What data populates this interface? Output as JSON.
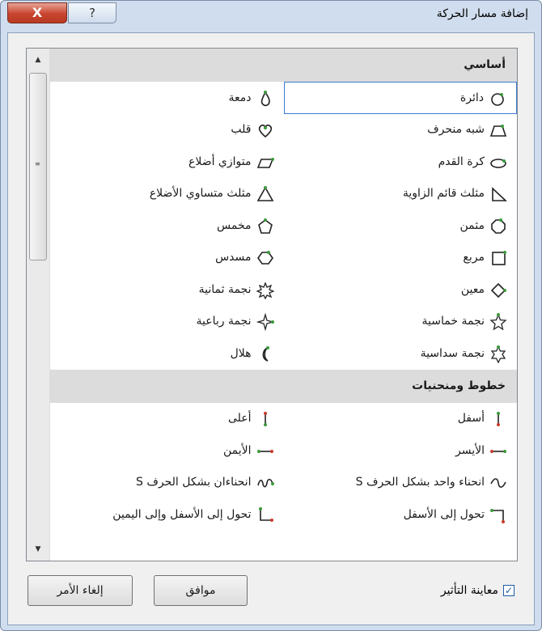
{
  "window": {
    "title": "إضافة مسار الحركة"
  },
  "titlebar": {
    "close_label": "X",
    "help_label": "?"
  },
  "groups": [
    {
      "header": "أساسي",
      "items": [
        {
          "label": "دائرة",
          "icon": "circle-icon"
        },
        {
          "label": "دمعة",
          "icon": "teardrop-icon"
        },
        {
          "label": "شبه منحرف",
          "icon": "trapezoid-icon"
        },
        {
          "label": "قلب",
          "icon": "heart-icon"
        },
        {
          "label": "كرة القدم",
          "icon": "football-icon"
        },
        {
          "label": "متوازي أضلاع",
          "icon": "parallelogram-icon"
        },
        {
          "label": "مثلث قائم الزاوية",
          "icon": "right-triangle-icon"
        },
        {
          "label": "مثلث متساوي الأضلاع",
          "icon": "equilateral-triangle-icon"
        },
        {
          "label": "مثمن",
          "icon": "octagon-icon"
        },
        {
          "label": "مخمس",
          "icon": "pentagon-icon"
        },
        {
          "label": "مربع",
          "icon": "square-icon"
        },
        {
          "label": "مسدس",
          "icon": "hexagon-icon"
        },
        {
          "label": "معين",
          "icon": "diamond-icon"
        },
        {
          "label": "نجمة ثمانية",
          "icon": "eight-point-star-icon"
        },
        {
          "label": "نجمة خماسية",
          "icon": "five-point-star-icon"
        },
        {
          "label": "نجمة رباعية",
          "icon": "four-point-star-icon"
        },
        {
          "label": "نجمة سداسية",
          "icon": "six-point-star-icon"
        },
        {
          "label": "هلال",
          "icon": "crescent-icon"
        }
      ]
    },
    {
      "header": "خطوط ومنحنيات",
      "items": [
        {
          "label": "أسفل",
          "icon": "line-down-icon"
        },
        {
          "label": "أعلى",
          "icon": "line-up-icon"
        },
        {
          "label": "الأيسر",
          "icon": "line-left-icon"
        },
        {
          "label": "الأيمن",
          "icon": "line-right-icon"
        },
        {
          "label": "انحناء واحد بشكل الحرف S",
          "icon": "s-curve-1-icon"
        },
        {
          "label": "انحناءان بشكل الحرف S",
          "icon": "s-curve-2-icon"
        },
        {
          "label": "تحول إلى الأسفل",
          "icon": "turn-down-icon"
        },
        {
          "label": "تحول إلى الأسفل وإلى اليمين",
          "icon": "turn-down-right-icon"
        }
      ]
    }
  ],
  "selected_item": "دائرة",
  "footer": {
    "preview_label": "معاينة التأثير",
    "preview_checked": true,
    "ok_label": "موافق",
    "cancel_label": "إلغاء الأمر"
  },
  "colors": {
    "selection_border": "#3a7bd5",
    "header_bg": "#dcdcdc",
    "dialog_bg": "#f0f0f0"
  }
}
